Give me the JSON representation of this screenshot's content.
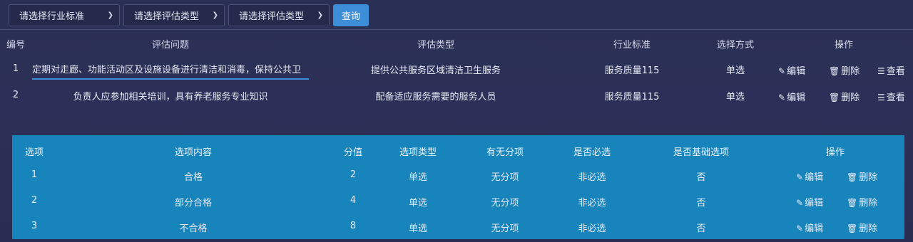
{
  "filters": {
    "industry_placeholder": "请选择行业标准",
    "eval_type_placeholder_1": "请选择评估类型",
    "eval_type_placeholder_2": "请选择评估类型",
    "query_label": "查询"
  },
  "main_table": {
    "headers": {
      "id": "编号",
      "question": "评估问题",
      "type": "评估类型",
      "standard": "行业标准",
      "method": "选择方式",
      "ops": "操作"
    },
    "rows": [
      {
        "id": "1",
        "question": "定期对走廊、功能活动区及设施设备进行清洁和消毒，保持公共卫",
        "type": "提供公共服务区域清洁卫生服务",
        "standard": "服务质量115",
        "method": "单选",
        "edit": "编辑",
        "delete": "删除",
        "view": "查看"
      },
      {
        "id": "2",
        "question": "负责人应参加相关培训，具有养老服务专业知识",
        "type": "配备适应服务需要的服务人员",
        "standard": "服务质量115",
        "method": "单选",
        "edit": "编辑",
        "delete": "删除",
        "view": "查看"
      }
    ]
  },
  "options_table": {
    "headers": {
      "option": "选项",
      "content": "选项内容",
      "score": "分值",
      "opt_type": "选项类型",
      "has_score": "有无分项",
      "required": "是否必选",
      "basic": "是否基础选项",
      "ops": "操作"
    },
    "rows": [
      {
        "option": "1",
        "content": "合格",
        "score": "2",
        "opt_type": "单选",
        "has_score": "无分项",
        "required": "非必选",
        "basic": "否",
        "edit": "编辑",
        "delete": "删除"
      },
      {
        "option": "2",
        "content": "部分合格",
        "score": "4",
        "opt_type": "单选",
        "has_score": "无分项",
        "required": "非必选",
        "basic": "否",
        "edit": "编辑",
        "delete": "删除"
      },
      {
        "option": "3",
        "content": "不合格",
        "score": "8",
        "opt_type": "单选",
        "has_score": "无分项",
        "required": "非必选",
        "basic": "否",
        "edit": "编辑",
        "delete": "删除"
      }
    ]
  },
  "colors": {
    "background": "#2b2f56",
    "accent": "#3d8ed8",
    "panel": "#1784bc"
  }
}
